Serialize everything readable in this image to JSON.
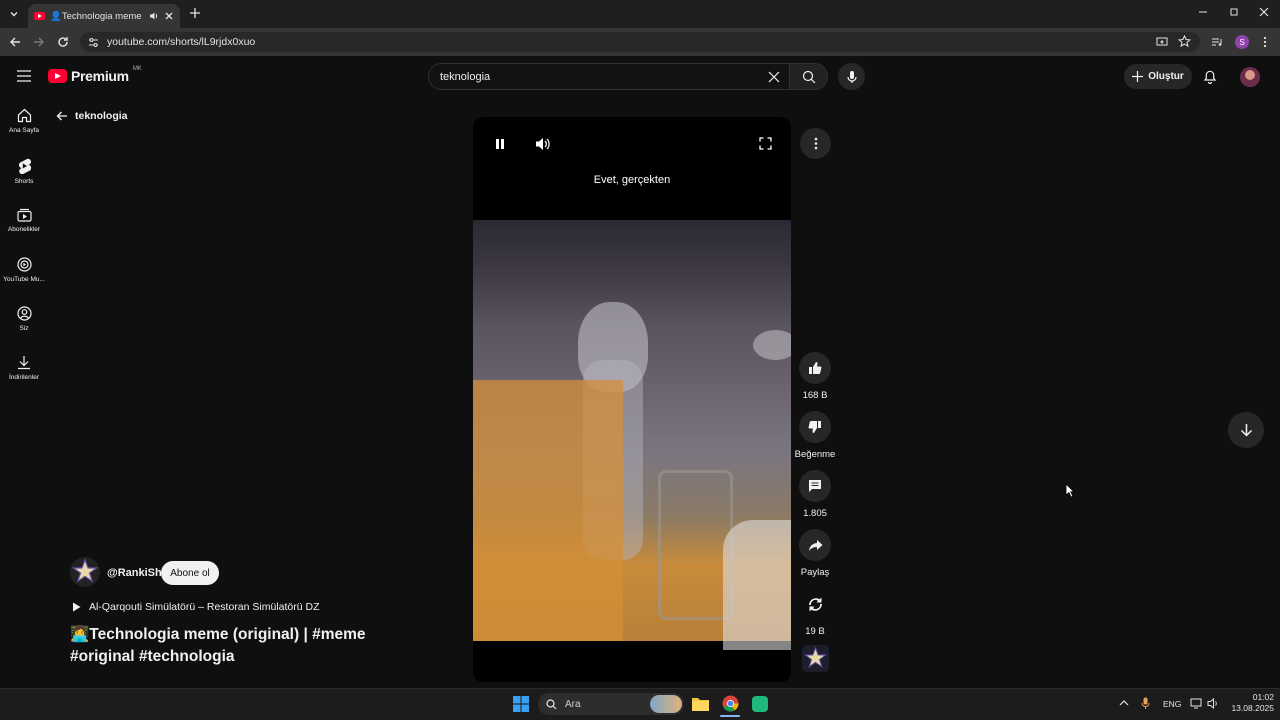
{
  "browser": {
    "tab_title": "👤Technologia meme (orig",
    "url": "youtube.com/shorts/lL9rjdx0xuo"
  },
  "youtube": {
    "logo_text": "Premium",
    "logo_badge": "MK",
    "search_value": "teknologia",
    "create_label": "Oluştur",
    "back_label": "teknologia",
    "nav": [
      {
        "label": "Ana Sayfa",
        "icon": "home-icon"
      },
      {
        "label": "Shorts",
        "icon": "shorts-icon"
      },
      {
        "label": "Abonelikler",
        "icon": "subscriptions-icon"
      },
      {
        "label": "YouTube Mu...",
        "icon": "youtube-music-icon"
      },
      {
        "label": "Siz",
        "icon": "you-icon"
      },
      {
        "label": "İndirilenler",
        "icon": "download-icon"
      }
    ],
    "video_caption": "Evet, gerçekten",
    "actions": {
      "likes": "168 B",
      "dislike": "Beğenme",
      "comments": "1.805",
      "share": "Paylaş",
      "remix": "19 B"
    },
    "channel": "@RankiSh",
    "subscribe_label": "Abone ol",
    "music": "Al-Qarqouti Simülatörü – Restoran Simülatörü DZ",
    "title": "👩‍💻Technologia meme (original) | #meme #original #technologia"
  },
  "taskbar": {
    "search_placeholder": "Ara",
    "language": "ENG",
    "time": "01:02",
    "date": "13.08.2025"
  },
  "colors": {
    "background": "#0f0f0f",
    "youtube_red": "#ff0033",
    "chrome_dark": "#1f1f1f"
  }
}
